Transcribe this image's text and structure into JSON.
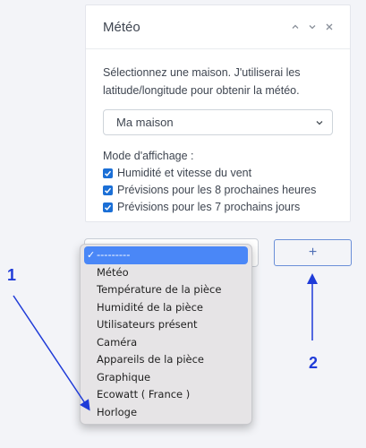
{
  "card": {
    "title": "Météo",
    "description": "Sélectionnez une maison. J'utiliserai les latitude/longitude pour obtenir la météo.",
    "house_select_value": "Ma maison",
    "mode_label": "Mode d'affichage :",
    "checkboxes": [
      {
        "label": "Humidité et vitesse du vent",
        "checked": true
      },
      {
        "label": "Prévisions pour les 8 prochaines heures",
        "checked": true
      },
      {
        "label": "Prévisions pour les 7 prochains jours",
        "checked": true
      }
    ]
  },
  "dropdown": {
    "options": [
      "---------",
      "Météo",
      "Température de la pièce",
      "Humidité de la pièce",
      "Utilisateurs présent",
      "Caméra",
      "Appareils de la pièce",
      "Graphique",
      "Ecowatt ( France )",
      "Horloge"
    ],
    "selected_index": 0
  },
  "add_button_label": "+",
  "annotations": {
    "one": "1",
    "two": "2"
  },
  "colors": {
    "accent": "#1b6fd6",
    "annotation": "#1f3bd8",
    "selected": "#4a87f7"
  }
}
